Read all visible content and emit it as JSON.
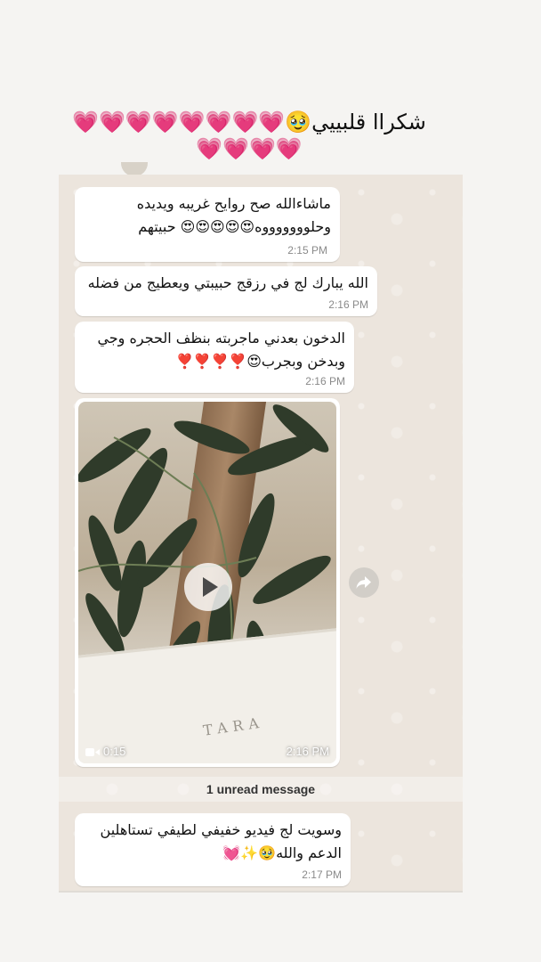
{
  "caption": {
    "line1": "شكرا‎ا قلبييي🥹💗💗💗💗💗💗💗💗",
    "line2": "💗💗💗💗"
  },
  "messages": [
    {
      "text_line1": "ماشاءالله صح روايح غريبه ويديده",
      "text_line2": "وحلوووووووه😍😍😍😍😍 حبيتهم",
      "time": "2:15 PM"
    },
    {
      "text_line1": "الله يبارك لج في رزقج حبيبتي ويعطيج من فضله",
      "time": "2:16 PM"
    },
    {
      "text_line1": "الدخون بعدني ماجربته بنظف الحجره وجي",
      "text_line2": "وبدخن وبجرب😍❣️❣️❣️❣️",
      "time": "2:16 PM"
    }
  ],
  "video": {
    "duration": "0:15",
    "time": "2:16 PM",
    "box_label": "TARA",
    "icons": {
      "play": "play-icon",
      "camera": "video-camera-icon",
      "forward": "forward-icon"
    }
  },
  "unread": {
    "label": "1 unread message"
  },
  "last_message": {
    "text_line1": "وسويت لج فيديو خفيفي لطيفي تستاهلين",
    "text_line2": "الدعم والله🥹✨💓",
    "time": "2:17 PM"
  },
  "colors": {
    "chat_bg": "#ece5dd",
    "bubble_bg": "#ffffff",
    "time_text": "#8a8a8a"
  }
}
